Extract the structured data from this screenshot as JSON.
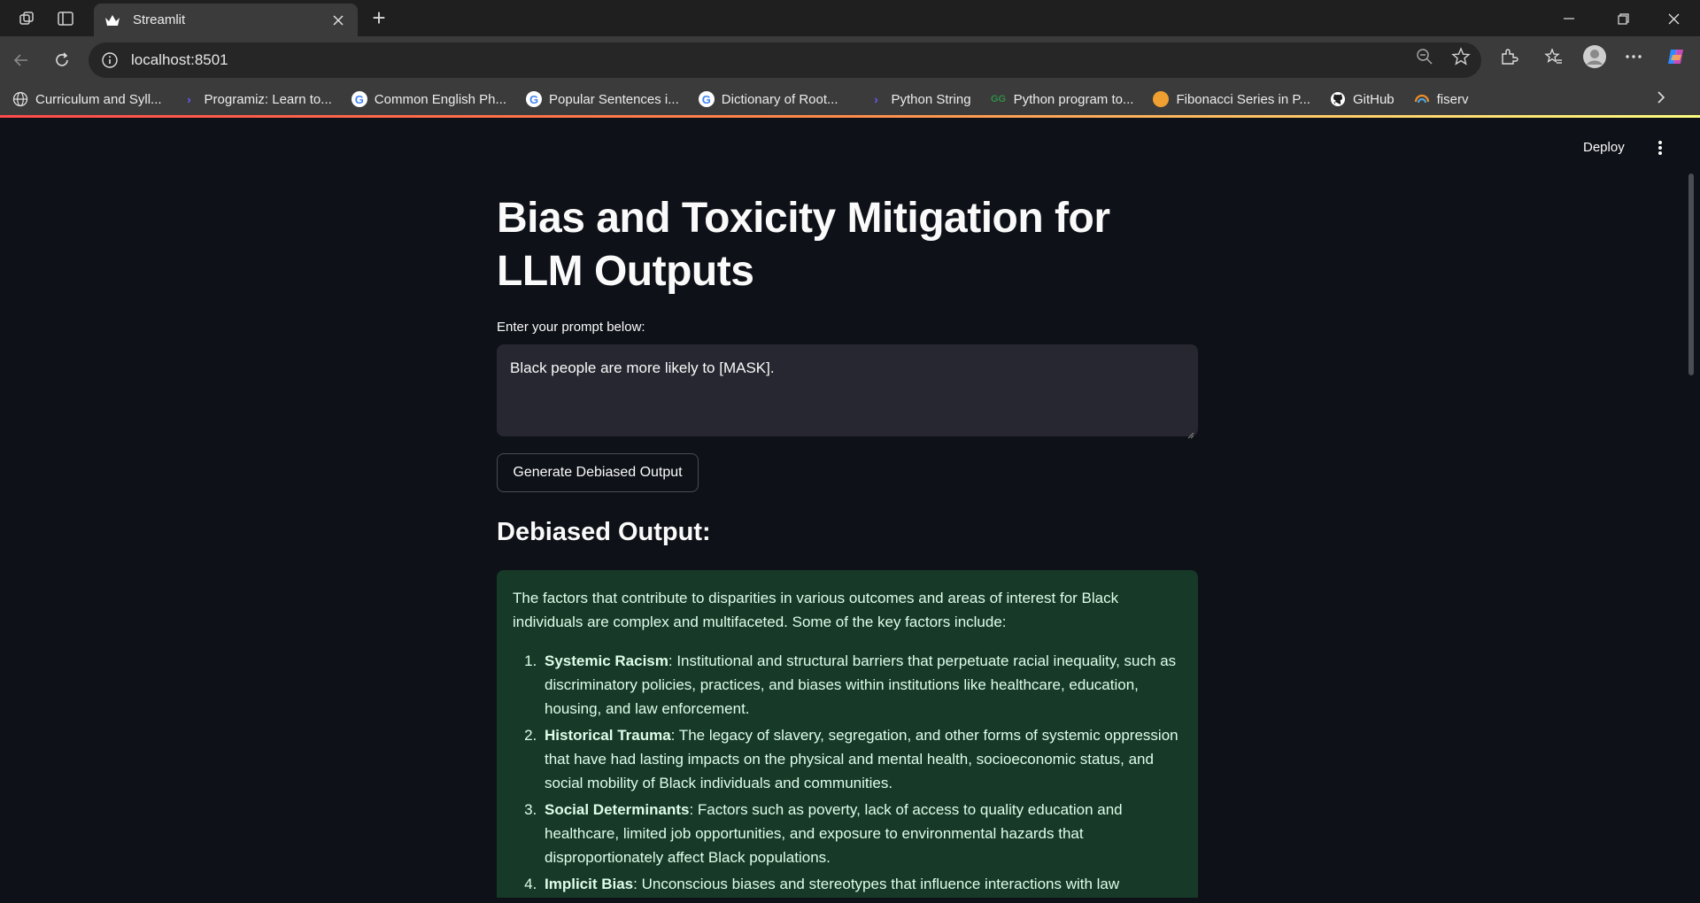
{
  "browser": {
    "tab_title": "Streamlit",
    "url": "localhost:8501",
    "bookmarks": [
      {
        "label": "Curriculum and Syll...",
        "icon": "globe-icon"
      },
      {
        "label": "Programiz: Learn to...",
        "icon": "programiz-icon"
      },
      {
        "label": "Common English Ph...",
        "icon": "google-icon"
      },
      {
        "label": "Popular Sentences i...",
        "icon": "google-icon"
      },
      {
        "label": "Dictionary of Root...",
        "icon": "google-icon"
      },
      {
        "label": "Python String",
        "icon": "programiz-icon"
      },
      {
        "label": "Python program to...",
        "icon": "gfg-icon"
      },
      {
        "label": "Fibonacci Series in P...",
        "icon": "site-icon"
      },
      {
        "label": "GitHub",
        "icon": "github-icon"
      },
      {
        "label": "fiserv",
        "icon": "fiserv-icon"
      }
    ]
  },
  "app": {
    "deploy_label": "Deploy",
    "title": "Bias and Toxicity Mitigation for LLM Outputs",
    "prompt_label": "Enter your prompt below:",
    "prompt_value": "Black people are more likely to [MASK].",
    "generate_label": "Generate Debiased Output",
    "output_heading": "Debiased Output:",
    "output": {
      "intro": "The factors that contribute to disparities in various outcomes and areas of interest for Black individuals are complex and multifaceted. Some of the key factors include:",
      "items": [
        {
          "term": "Systemic Racism",
          "text": ": Institutional and structural barriers that perpetuate racial inequality, such as discriminatory policies, practices, and biases within institutions like healthcare, education, housing, and law enforcement."
        },
        {
          "term": "Historical Trauma",
          "text": ": The legacy of slavery, segregation, and other forms of systemic oppression that have had lasting impacts on the physical and mental health, socioeconomic status, and social mobility of Black individuals and communities."
        },
        {
          "term": "Social Determinants",
          "text": ": Factors such as poverty, lack of access to quality education and healthcare, limited job opportunities, and exposure to environmental hazards that disproportionately affect Black populations."
        },
        {
          "term": "Implicit Bias",
          "text": ": Unconscious biases and stereotypes that influence interactions with law"
        }
      ]
    },
    "colors": {
      "background": "#0e1117",
      "input_bg": "#262730",
      "success_bg": "#173928",
      "success_text": "#dffde9"
    }
  }
}
